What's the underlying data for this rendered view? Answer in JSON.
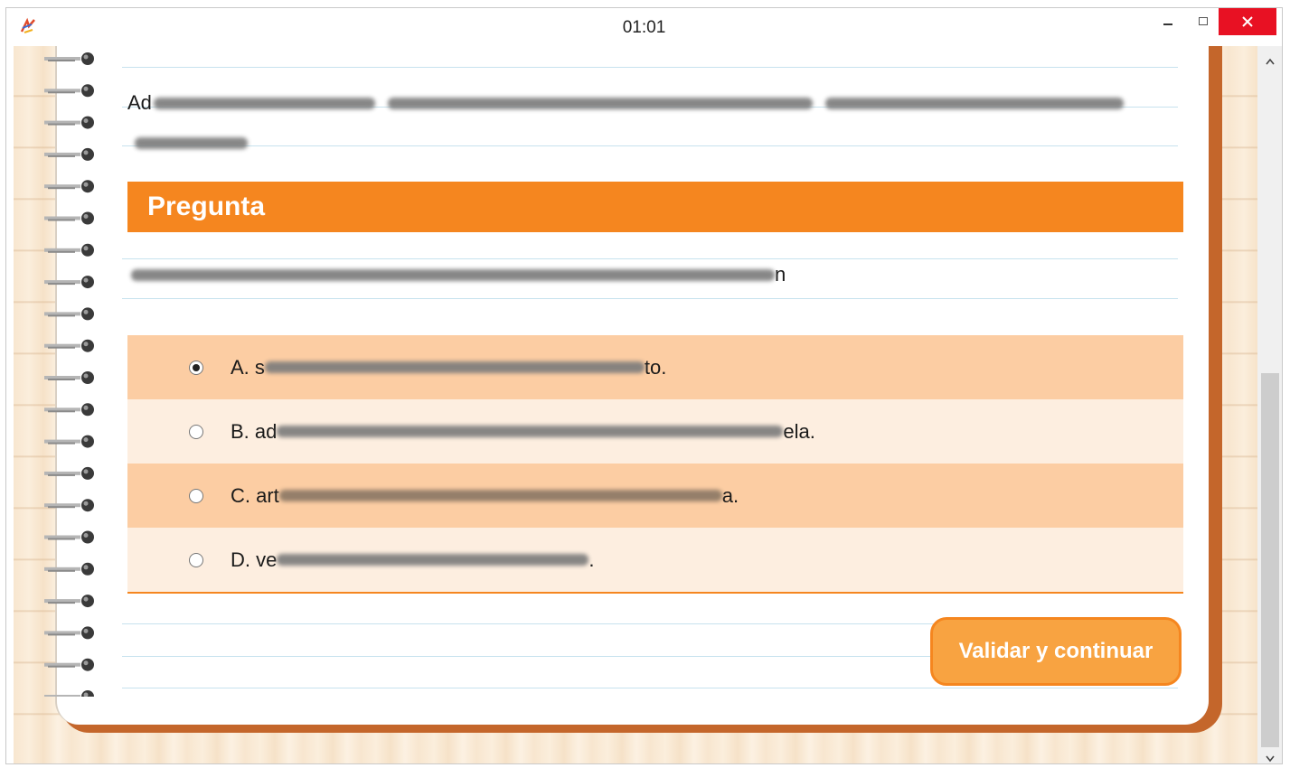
{
  "window": {
    "title": "01:01",
    "minimize_label": "‒",
    "maximize_label": "☐",
    "close_label": "✕",
    "app_icon": "app-logo-icon"
  },
  "lesson": {
    "intro_prefix": "Ad",
    "intro_second_line_visible": ""
  },
  "question": {
    "header": "Pregunta",
    "text_suffix": "n",
    "options": [
      {
        "prefix": "A. s",
        "suffix": "to.",
        "selected": true
      },
      {
        "prefix": "B. ad",
        "suffix": "ela.",
        "selected": false
      },
      {
        "prefix": "C. art",
        "suffix": "a.",
        "selected": false
      },
      {
        "prefix": "D. ve",
        "suffix": ".",
        "selected": false
      }
    ]
  },
  "actions": {
    "validate_label": "Validar y continuar"
  },
  "colors": {
    "accent": "#f5861f",
    "option_dark": "#fccda3",
    "option_light": "#fdeee0",
    "button": "#f8a341",
    "close": "#e81123",
    "notebook_edge": "#c4662b"
  },
  "icons": {
    "scroll_up": "chevron-up-icon",
    "scroll_down": "chevron-down-icon",
    "radio": "radio-button-icon"
  }
}
